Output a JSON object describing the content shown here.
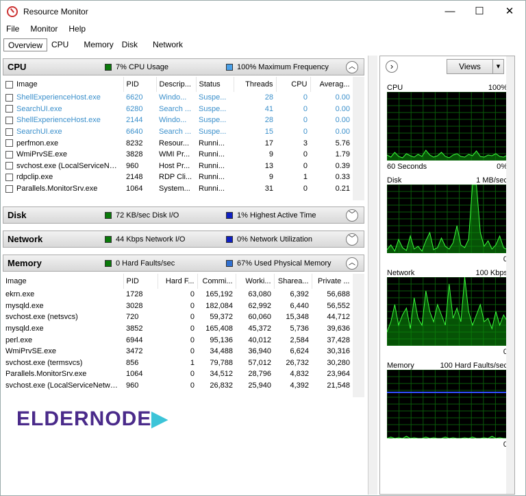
{
  "window": {
    "title": "Resource Monitor",
    "minimize": "—",
    "maximize": "☐",
    "close": "✕"
  },
  "menu": [
    "File",
    "Monitor",
    "Help"
  ],
  "tabs": [
    "Overview",
    "CPU",
    "Memory",
    "Disk",
    "Network"
  ],
  "cpu": {
    "title": "CPU",
    "stat1": "7% CPU Usage",
    "stat1_color": "#0a7a0a",
    "stat2": "100% Maximum Frequency",
    "stat2_color": "#4aa0e8",
    "columns": [
      "Image",
      "PID",
      "Descrip...",
      "Status",
      "Threads",
      "CPU",
      "Averag..."
    ],
    "rows": [
      [
        "ShellExperienceHost.exe",
        "6620",
        "Windo...",
        "Suspe...",
        "28",
        "0",
        "0.00",
        true
      ],
      [
        "SearchUI.exe",
        "6280",
        "Search ...",
        "Suspe...",
        "41",
        "0",
        "0.00",
        true
      ],
      [
        "ShellExperienceHost.exe",
        "2144",
        "Windo...",
        "Suspe...",
        "28",
        "0",
        "0.00",
        true
      ],
      [
        "SearchUI.exe",
        "6640",
        "Search ...",
        "Suspe...",
        "15",
        "0",
        "0.00",
        true
      ],
      [
        "perfmon.exe",
        "8232",
        "Resour...",
        "Runni...",
        "17",
        "3",
        "5.76",
        false
      ],
      [
        "WmiPrvSE.exe",
        "3828",
        "WMI Pr...",
        "Runni...",
        "9",
        "0",
        "1.79",
        false
      ],
      [
        "svchost.exe (LocalServiceNet...",
        "960",
        "Host Pr...",
        "Runni...",
        "13",
        "0",
        "0.39",
        false
      ],
      [
        "rdpclip.exe",
        "2148",
        "RDP Cli...",
        "Runni...",
        "9",
        "1",
        "0.33",
        false
      ],
      [
        "Parallels.MonitorSrv.exe",
        "1064",
        "System...",
        "Runni...",
        "31",
        "0",
        "0.21",
        false
      ]
    ]
  },
  "disk": {
    "title": "Disk",
    "stat1": "72 KB/sec Disk I/O",
    "stat1_color": "#0a7a0a",
    "stat2": "1% Highest Active Time",
    "stat2_color": "#1020c0"
  },
  "network": {
    "title": "Network",
    "stat1": "44 Kbps Network I/O",
    "stat1_color": "#0a7a0a",
    "stat2": "0% Network Utilization",
    "stat2_color": "#1020c0"
  },
  "memory": {
    "title": "Memory",
    "stat1": "0 Hard Faults/sec",
    "stat1_color": "#0a7a0a",
    "stat2": "67% Used Physical Memory",
    "stat2_color": "#3070d0",
    "columns": [
      "Image",
      "PID",
      "Hard F...",
      "Commi...",
      "Worki...",
      "Sharea...",
      "Private ..."
    ],
    "rows": [
      [
        "ekrn.exe",
        "1728",
        "0",
        "165,192",
        "63,080",
        "6,392",
        "56,688"
      ],
      [
        "mysqld.exe",
        "3028",
        "0",
        "182,084",
        "62,992",
        "6,440",
        "56,552"
      ],
      [
        "svchost.exe (netsvcs)",
        "720",
        "0",
        "59,372",
        "60,060",
        "15,348",
        "44,712"
      ],
      [
        "mysqld.exe",
        "3852",
        "0",
        "165,408",
        "45,372",
        "5,736",
        "39,636"
      ],
      [
        "perl.exe",
        "6944",
        "0",
        "95,136",
        "40,012",
        "2,584",
        "37,428"
      ],
      [
        "WmiPrvSE.exe",
        "3472",
        "0",
        "34,488",
        "36,940",
        "6,624",
        "30,316"
      ],
      [
        "svchost.exe (termsvcs)",
        "856",
        "1",
        "79,788",
        "57,012",
        "26,732",
        "30,280"
      ],
      [
        "Parallels.MonitorSrv.exe",
        "1064",
        "0",
        "34,512",
        "28,796",
        "4,832",
        "23,964"
      ],
      [
        "svchost.exe (LocalServiceNetwo...",
        "960",
        "0",
        "26,832",
        "25,940",
        "4,392",
        "21,548"
      ]
    ]
  },
  "logo": {
    "text": "eldernode"
  },
  "views": {
    "expand": "›",
    "label": "Views",
    "dropdown": "▾"
  },
  "graphs": [
    {
      "label": "CPU",
      "max": "100%",
      "foot_left": "60 Seconds",
      "foot_right": "0%",
      "samples": [
        8,
        5,
        12,
        6,
        4,
        10,
        7,
        5,
        9,
        6,
        15,
        8,
        5,
        7,
        12,
        6,
        4,
        8,
        10,
        6,
        5,
        9,
        7,
        14,
        6,
        5,
        8,
        7,
        10,
        6,
        5,
        8
      ]
    },
    {
      "label": "Disk",
      "max": "1 MB/sec",
      "foot_left": "",
      "foot_right": "0",
      "samples": [
        5,
        12,
        3,
        20,
        8,
        4,
        25,
        6,
        10,
        3,
        18,
        30,
        5,
        8,
        22,
        10,
        6,
        15,
        40,
        12,
        8,
        20,
        100,
        100,
        30,
        10,
        18,
        6,
        12,
        25,
        8,
        5
      ]
    },
    {
      "label": "Network",
      "max": "100 Kbps",
      "foot_left": "",
      "foot_right": "0",
      "samples": [
        20,
        35,
        60,
        30,
        45,
        55,
        25,
        70,
        40,
        30,
        80,
        50,
        35,
        60,
        45,
        30,
        90,
        40,
        55,
        35,
        100,
        50,
        30,
        45,
        60,
        35,
        40,
        25,
        50,
        30,
        45,
        35
      ]
    },
    {
      "label": "Memory",
      "max": "100 Hard Faults/sec",
      "foot_left": "",
      "foot_right": "0",
      "samples": [
        0,
        2,
        0,
        1,
        0,
        3,
        0,
        1,
        0,
        0,
        2,
        0,
        1,
        0,
        0,
        2,
        0,
        1,
        0,
        0,
        1,
        0,
        2,
        0,
        0,
        1,
        0,
        3,
        0,
        1,
        0,
        0
      ],
      "line": 67
    }
  ]
}
